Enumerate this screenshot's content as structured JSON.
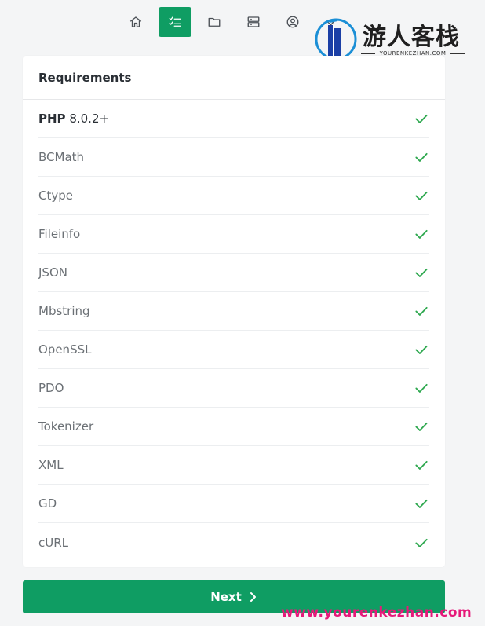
{
  "stepnav": {
    "steps": [
      {
        "icon": "home-icon",
        "active": false
      },
      {
        "icon": "checklist-icon",
        "active": true
      },
      {
        "icon": "folder-icon",
        "active": false
      },
      {
        "icon": "server-icon",
        "active": false
      },
      {
        "icon": "user-circle-icon",
        "active": false
      },
      {
        "icon": "check-icon",
        "active": false
      }
    ]
  },
  "watermark": {
    "title": "游人客栈",
    "subtitle": "YOURENKEZHAN.COM",
    "url": "www.yourenkezhan.com"
  },
  "card": {
    "title": "Requirements",
    "php": {
      "label": "PHP",
      "version": "8.0.2+"
    },
    "requirements": [
      {
        "name": "BCMath",
        "status": "ok"
      },
      {
        "name": "Ctype",
        "status": "ok"
      },
      {
        "name": "Fileinfo",
        "status": "ok"
      },
      {
        "name": "JSON",
        "status": "ok"
      },
      {
        "name": "Mbstring",
        "status": "ok"
      },
      {
        "name": "OpenSSL",
        "status": "ok"
      },
      {
        "name": "PDO",
        "status": "ok"
      },
      {
        "name": "Tokenizer",
        "status": "ok"
      },
      {
        "name": "XML",
        "status": "ok"
      },
      {
        "name": "GD",
        "status": "ok"
      },
      {
        "name": "cURL",
        "status": "ok"
      }
    ]
  },
  "next_button": {
    "label": "Next"
  },
  "colors": {
    "accent": "#0f9d63",
    "check": "#2ea84f",
    "watermark_pink": "#e6197a"
  }
}
